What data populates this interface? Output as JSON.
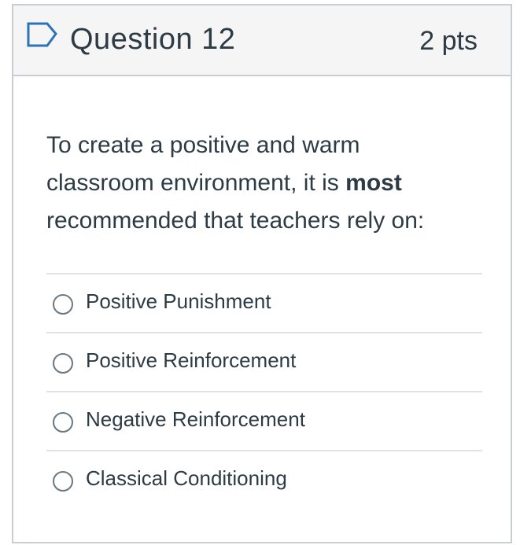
{
  "header": {
    "title": "Question 12",
    "points": "2 pts",
    "flag_icon": "flag-outline-icon"
  },
  "question": {
    "text_before": "To create a positive and warm classroom environment, it is ",
    "emphasis": "most",
    "text_after": " recommended that teachers rely on:"
  },
  "answers": [
    {
      "label": "Positive Punishment",
      "selected": false
    },
    {
      "label": "Positive Reinforcement",
      "selected": false
    },
    {
      "label": "Negative Reinforcement",
      "selected": false
    },
    {
      "label": "Classical Conditioning",
      "selected": false
    }
  ],
  "colors": {
    "text": "#2d3b45",
    "border": "#c7cdd1",
    "header_bg": "#f5f5f5",
    "flag": "#2d72b8"
  }
}
